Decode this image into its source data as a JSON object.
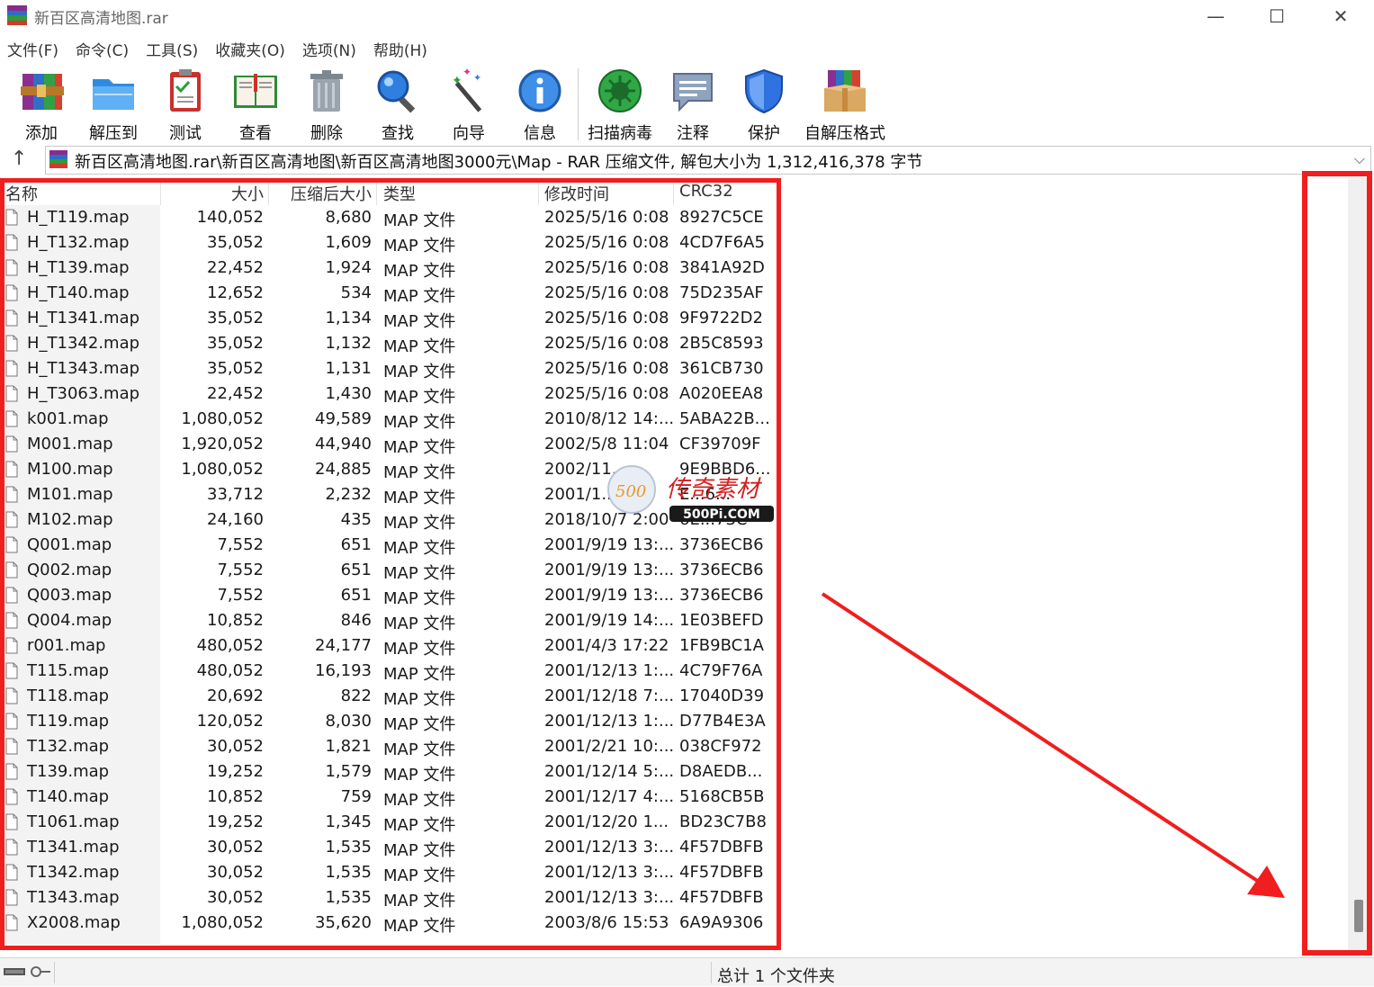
{
  "window": {
    "title": "新百区高清地图.rar",
    "minimize": "—",
    "maximize": "☐",
    "close": "✕"
  },
  "menu": [
    "文件(F)",
    "命令(C)",
    "工具(S)",
    "收藏夹(O)",
    "选项(N)",
    "帮助(H)"
  ],
  "toolbar": [
    {
      "label": "添加",
      "icon": "add-archive-icon"
    },
    {
      "label": "解压到",
      "icon": "extract-folder-icon"
    },
    {
      "label": "测试",
      "icon": "test-clipboard-icon"
    },
    {
      "label": "查看",
      "icon": "view-book-icon"
    },
    {
      "label": "删除",
      "icon": "trash-icon"
    },
    {
      "label": "查找",
      "icon": "magnifier-icon"
    },
    {
      "label": "向导",
      "icon": "wizard-wand-icon"
    },
    {
      "label": "信息",
      "icon": "info-icon"
    },
    {
      "label": "扫描病毒",
      "icon": "virus-scan-icon"
    },
    {
      "label": "注释",
      "icon": "comment-icon"
    },
    {
      "label": "保护",
      "icon": "shield-icon"
    },
    {
      "label": "自解压格式",
      "icon": "sfx-box-icon"
    }
  ],
  "address": {
    "path": "新百区高清地图.rar\\新百区高清地图\\新百区高清地图3000元\\Map - RAR 压缩文件, 解包大小为 1,312,416,378 字节"
  },
  "columns": {
    "name": "名称",
    "size": "大小",
    "packed": "压缩后大小",
    "type": "类型",
    "modified": "修改时间",
    "crc": "CRC32"
  },
  "files": [
    {
      "name": "H_T119.map",
      "size": "140,052",
      "packed": "8,680",
      "type": "MAP 文件",
      "modified": "2025/5/16 0:08",
      "crc": "8927C5CE"
    },
    {
      "name": "H_T132.map",
      "size": "35,052",
      "packed": "1,609",
      "type": "MAP 文件",
      "modified": "2025/5/16 0:08",
      "crc": "4CD7F6A5"
    },
    {
      "name": "H_T139.map",
      "size": "22,452",
      "packed": "1,924",
      "type": "MAP 文件",
      "modified": "2025/5/16 0:08",
      "crc": "3841A92D"
    },
    {
      "name": "H_T140.map",
      "size": "12,652",
      "packed": "534",
      "type": "MAP 文件",
      "modified": "2025/5/16 0:08",
      "crc": "75D235AF"
    },
    {
      "name": "H_T1341.map",
      "size": "35,052",
      "packed": "1,134",
      "type": "MAP 文件",
      "modified": "2025/5/16 0:08",
      "crc": "9F9722D2"
    },
    {
      "name": "H_T1342.map",
      "size": "35,052",
      "packed": "1,132",
      "type": "MAP 文件",
      "modified": "2025/5/16 0:08",
      "crc": "2B5C8593"
    },
    {
      "name": "H_T1343.map",
      "size": "35,052",
      "packed": "1,131",
      "type": "MAP 文件",
      "modified": "2025/5/16 0:08",
      "crc": "361CB730"
    },
    {
      "name": "H_T3063.map",
      "size": "22,452",
      "packed": "1,430",
      "type": "MAP 文件",
      "modified": "2025/5/16 0:08",
      "crc": "A020EEA8"
    },
    {
      "name": "k001.map",
      "size": "1,080,052",
      "packed": "49,589",
      "type": "MAP 文件",
      "modified": "2010/8/12 14:...",
      "crc": "5ABA22B..."
    },
    {
      "name": "M001.map",
      "size": "1,920,052",
      "packed": "44,940",
      "type": "MAP 文件",
      "modified": "2002/5/8 11:04",
      "crc": "CF39709F"
    },
    {
      "name": "M100.map",
      "size": "1,080,052",
      "packed": "24,885",
      "type": "MAP 文件",
      "modified": "2002/11...",
      "crc": "9E9BBD6..."
    },
    {
      "name": "M101.map",
      "size": "33,712",
      "packed": "2,232",
      "type": "MAP 文件",
      "modified": "2001/1...",
      "crc": "E...6..."
    },
    {
      "name": "M102.map",
      "size": "24,160",
      "packed": "435",
      "type": "MAP 文件",
      "modified": "2018/10/7 2:00",
      "crc": "6E...73C"
    },
    {
      "name": "Q001.map",
      "size": "7,552",
      "packed": "651",
      "type": "MAP 文件",
      "modified": "2001/9/19 13:...",
      "crc": "3736ECB6"
    },
    {
      "name": "Q002.map",
      "size": "7,552",
      "packed": "651",
      "type": "MAP 文件",
      "modified": "2001/9/19 13:...",
      "crc": "3736ECB6"
    },
    {
      "name": "Q003.map",
      "size": "7,552",
      "packed": "651",
      "type": "MAP 文件",
      "modified": "2001/9/19 13:...",
      "crc": "3736ECB6"
    },
    {
      "name": "Q004.map",
      "size": "10,852",
      "packed": "846",
      "type": "MAP 文件",
      "modified": "2001/9/19 14:...",
      "crc": "1E03BEFD"
    },
    {
      "name": "r001.map",
      "size": "480,052",
      "packed": "24,177",
      "type": "MAP 文件",
      "modified": "2001/4/3 17:22",
      "crc": "1FB9BC1A"
    },
    {
      "name": "T115.map",
      "size": "480,052",
      "packed": "16,193",
      "type": "MAP 文件",
      "modified": "2001/12/13 1:...",
      "crc": "4C79F76A"
    },
    {
      "name": "T118.map",
      "size": "20,692",
      "packed": "822",
      "type": "MAP 文件",
      "modified": "2001/12/18 7:...",
      "crc": "17040D39"
    },
    {
      "name": "T119.map",
      "size": "120,052",
      "packed": "8,030",
      "type": "MAP 文件",
      "modified": "2001/12/13 1:...",
      "crc": "D77B4E3A"
    },
    {
      "name": "T132.map",
      "size": "30,052",
      "packed": "1,821",
      "type": "MAP 文件",
      "modified": "2001/2/21 10:...",
      "crc": "038CF972"
    },
    {
      "name": "T139.map",
      "size": "19,252",
      "packed": "1,579",
      "type": "MAP 文件",
      "modified": "2001/12/14 5:...",
      "crc": "D8AEDB..."
    },
    {
      "name": "T140.map",
      "size": "10,852",
      "packed": "759",
      "type": "MAP 文件",
      "modified": "2001/12/17 4:...",
      "crc": "5168CB5B"
    },
    {
      "name": "T1061.map",
      "size": "19,252",
      "packed": "1,345",
      "type": "MAP 文件",
      "modified": "2001/12/20 1...",
      "crc": "BD23C7B8"
    },
    {
      "name": "T1341.map",
      "size": "30,052",
      "packed": "1,535",
      "type": "MAP 文件",
      "modified": "2001/12/13 3:...",
      "crc": "4F57DBFB"
    },
    {
      "name": "T1342.map",
      "size": "30,052",
      "packed": "1,535",
      "type": "MAP 文件",
      "modified": "2001/12/13 3:...",
      "crc": "4F57DBFB"
    },
    {
      "name": "T1343.map",
      "size": "30,052",
      "packed": "1,535",
      "type": "MAP 文件",
      "modified": "2001/12/13 3:...",
      "crc": "4F57DBFB"
    },
    {
      "name": "X2008.map",
      "size": "1,080,052",
      "packed": "35,620",
      "type": "MAP 文件",
      "modified": "2003/8/6 15:53",
      "crc": "6A9A9306"
    }
  ],
  "watermark": {
    "site": "500Pi.COM",
    "badge": "500",
    "brand": "传奇素材"
  },
  "status": {
    "summary": "总计 1 个文件夹"
  },
  "colors": {
    "annotation_red": "#f01e1e"
  }
}
